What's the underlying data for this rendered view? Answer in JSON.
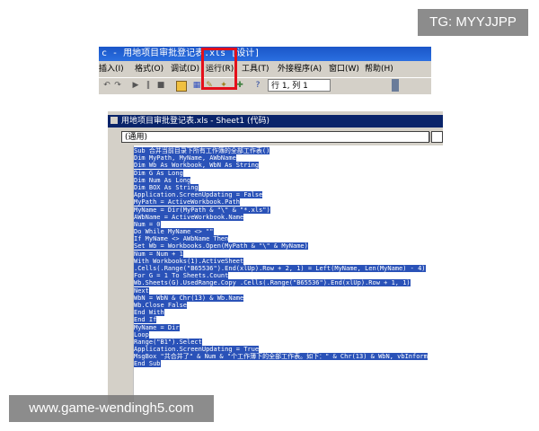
{
  "ide": {
    "title": "c - 用地项目审批登记表.xls [设计]",
    "menu": [
      "插入(I)",
      "格式(O)",
      "调试(D)",
      "运行(R)",
      "工具(T)",
      "外接程序(A)",
      "窗口(W)",
      "帮助(H)"
    ],
    "position": "行 1, 列 1"
  },
  "highlight_color": "#e4101b",
  "code_window": {
    "title": "用地项目审批登记表.xls - Sheet1 (代码)",
    "object_selector": "(通用)",
    "lines": [
      "Sub 合并当前目录下所有工作簿的全部工作表()",
      "Dim MyPath, MyName, AWbName",
      "Dim Wb As Workbook, WbN As String",
      "Dim G As Long",
      "Dim Num As Long",
      "Dim BOX As String",
      "Application.ScreenUpdating = False",
      "MyPath = ActiveWorkbook.Path",
      "MyName = Dir(MyPath & \"\\\" & \"*.xls\")",
      "AWbName = ActiveWorkbook.Name",
      "Num = 0",
      "Do While MyName <> \"\"",
      "If MyName <> AWbName Then",
      "Set Wb = Workbooks.Open(MyPath & \"\\\" & MyName)",
      "Num = Num + 1",
      "With Workbooks(1).ActiveSheet",
      ".Cells(.Range(\"B65536\").End(xlUp).Row + 2, 1) = Left(MyName, Len(MyName) - 4)",
      "For G = 1 To Sheets.Count",
      "Wb.Sheets(G).UsedRange.Copy .Cells(.Range(\"B65536\").End(xlUp).Row + 1, 1)",
      "Next",
      "WbN = WbN & Chr(13) & Wb.Name",
      "Wb.Close False",
      "End With",
      "End If",
      "MyName = Dir",
      "Loop",
      "Range(\"B1\").Select",
      "Application.ScreenUpdating = True",
      "MsgBox \"共合并了\" & Num & \"个工作薄下的全部工作表。如下：\" & Chr(13) & WbN, vbInform",
      "End Sub"
    ]
  },
  "watermarks": {
    "top": "TG: MYYJJPP",
    "bottom": "www.game-wendingh5.com"
  }
}
